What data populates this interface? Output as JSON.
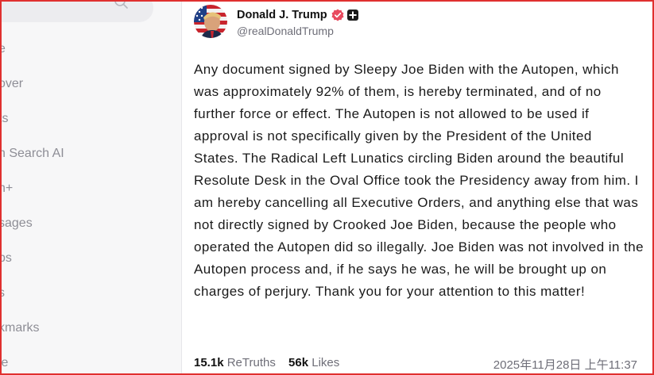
{
  "sidebar": {
    "search_icon": "search-icon",
    "items": [
      {
        "label": "e"
      },
      {
        "label": "over"
      },
      {
        "label": "ts"
      },
      {
        "label": "h Search AI"
      },
      {
        "label": "h+"
      },
      {
        "label": "sages"
      },
      {
        "label": "ps"
      },
      {
        "label": "s"
      },
      {
        "label": "kmarks"
      },
      {
        "label": "le"
      }
    ]
  },
  "post": {
    "author_name": "Donald J. Trump",
    "handle": "@realDonaldTrump",
    "verified_icon": "verified-badge-icon",
    "plus_icon": "plus-badge-icon",
    "paragraphs": [
      "Any document signed by Sleepy Joe Biden with the Autopen, which was approximately 92% of them, is hereby terminated, and of no further force or effect. The Autopen is not allowed to be used if approval is not specifically given by the President of the United",
      "States. The Radical Left Lunatics circling Biden around the beautiful Resolute Desk in the Oval Office took the Presidency away from him. I am hereby cancelling all Executive Orders, and anything else that was not directly signed by Crooked Joe Biden, because the people who operated the Autopen did so illegally. Joe Biden was not involved in the Autopen process and, if he says he was, he will be brought up on charges of perjury. Thank you for your attention to this matter!"
    ],
    "retruths_count": "15.1k",
    "retruths_label": "ReTruths",
    "likes_count": "56k",
    "likes_label": "Likes",
    "timestamp": "2025年11月28日 上午11:37"
  },
  "colors": {
    "accent_frame": "#e0302f",
    "verified": "#e84a5f",
    "text_muted": "#6e6e78"
  }
}
